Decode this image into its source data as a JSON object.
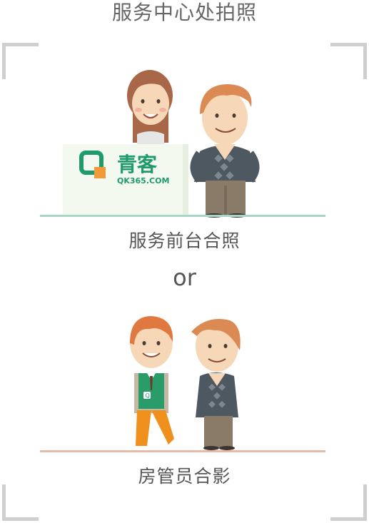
{
  "title": "服务中心处拍照",
  "option1": {
    "caption": "服务前台合照",
    "logo_cn": "青客",
    "logo_en": "QK365.COM"
  },
  "separator": "or",
  "option2": {
    "caption": "房管员合影",
    "badge": "Q"
  },
  "colors": {
    "accent_green": "#1f9b6b",
    "line_green": "#a9d6c8",
    "line_peach": "#e8b8a8"
  },
  "icons": [
    "receptionist-icon",
    "tenant-icon",
    "housing-manager-icon",
    "qingke-logo-icon"
  ]
}
